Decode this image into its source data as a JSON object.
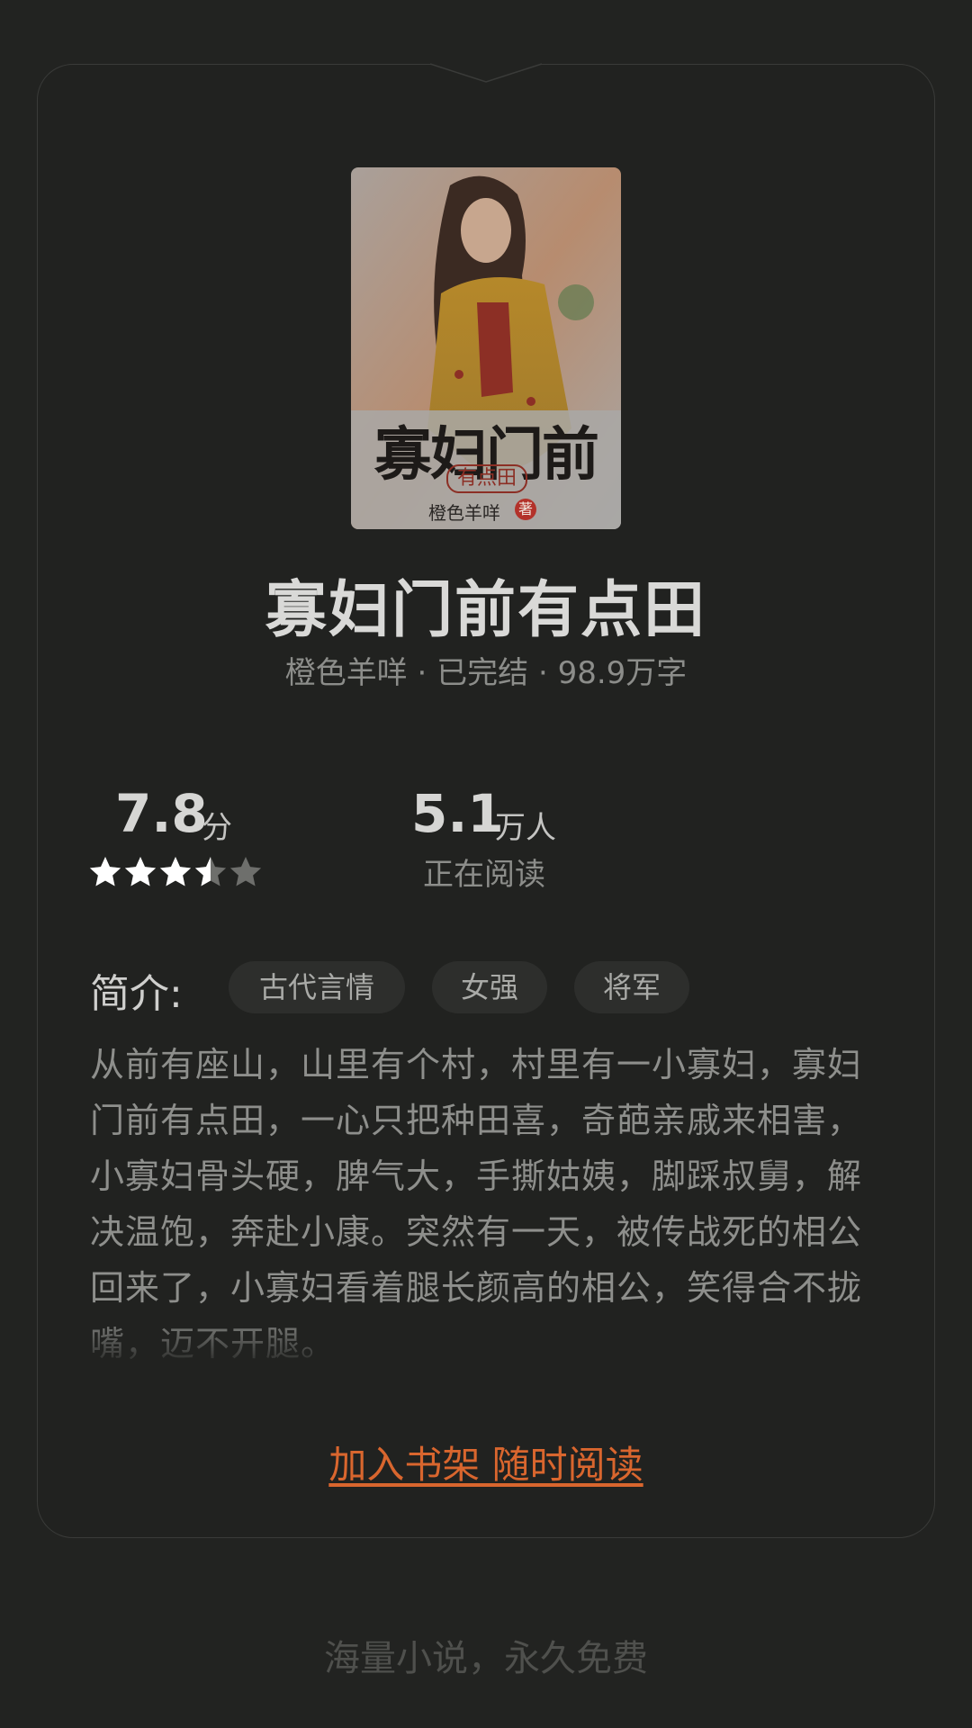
{
  "book": {
    "cover_title": "寡妇门前",
    "cover_subtitle": "有点田",
    "cover_author": "橙色羊咩",
    "cover_author_badge": "著",
    "title": "寡妇门前有点田",
    "meta": "橙色羊咩 · 已完结 · 98.9万字"
  },
  "rating": {
    "score": "7.8",
    "unit": "分",
    "stars_value": 3.5,
    "stars_max": 5
  },
  "readers": {
    "count": "5.1",
    "unit": "万人",
    "label": "正在阅读"
  },
  "intro": {
    "label": "简介:",
    "tags": [
      "古代言情",
      "女强",
      "将军"
    ],
    "text": "从前有座山，山里有个村，村里有一小寡妇，寡妇门前有点田，一心只把种田喜，奇葩亲戚来相害，小寡妇骨头硬，脾气大，手撕姑姨，脚踩叔舅，解决温饱，奔赴小康。突然有一天，被传战死的相公回来了，小寡妇看着腿长颜高的相公，笑得合不拢嘴，迈不开腿。"
  },
  "cta": {
    "label": "加入书架 随时阅读"
  },
  "footer": {
    "text": "海量小说，永久免费"
  },
  "colors": {
    "background": "#222321",
    "accent": "#d9662e",
    "star_on": "#ffffff",
    "star_off": "#6e6f6c"
  }
}
